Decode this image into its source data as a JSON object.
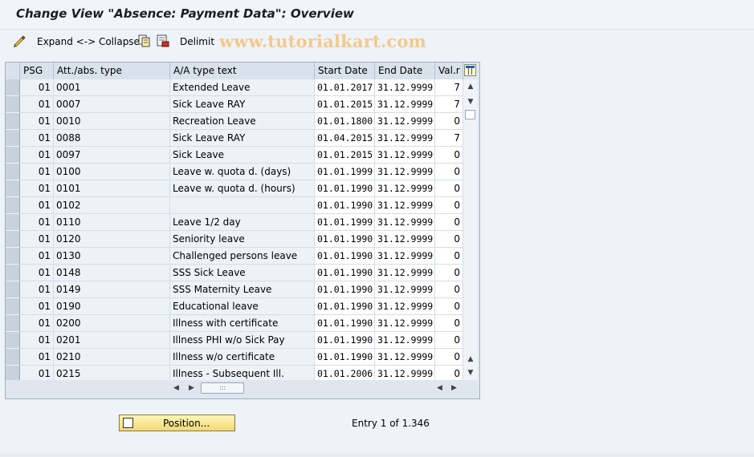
{
  "window": {
    "title": "Change View \"Absence: Payment Data\": Overview"
  },
  "toolbar": {
    "expand_collapse_label": "Expand <-> Collapse",
    "delimit_label": "Delimit"
  },
  "watermark": "www.tutorialkart.com",
  "table": {
    "headers": {
      "psg": "PSG",
      "type": "Att./abs. type",
      "text": "A/A type text",
      "start": "Start Date",
      "end": "End Date",
      "val": "Val.r"
    },
    "rows": [
      {
        "psg": "01",
        "type": "0001",
        "text": "Extended Leave",
        "start": "01.01.2017",
        "end": "31.12.9999",
        "val": "7"
      },
      {
        "psg": "01",
        "type": "0007",
        "text": "Sick Leave RAY",
        "start": "01.01.2015",
        "end": "31.12.9999",
        "val": "7"
      },
      {
        "psg": "01",
        "type": "0010",
        "text": "Recreation Leave",
        "start": "01.01.1800",
        "end": "31.12.9999",
        "val": "0"
      },
      {
        "psg": "01",
        "type": "0088",
        "text": "Sick Leave RAY",
        "start": "01.04.2015",
        "end": "31.12.9999",
        "val": "7"
      },
      {
        "psg": "01",
        "type": "0097",
        "text": "Sick Leave",
        "start": "01.01.2015",
        "end": "31.12.9999",
        "val": "0"
      },
      {
        "psg": "01",
        "type": "0100",
        "text": "Leave w. quota d. (days)",
        "start": "01.01.1999",
        "end": "31.12.9999",
        "val": "0"
      },
      {
        "psg": "01",
        "type": "0101",
        "text": "Leave w. quota d. (hours)",
        "start": "01.01.1990",
        "end": "31.12.9999",
        "val": "0"
      },
      {
        "psg": "01",
        "type": "0102",
        "text": "",
        "start": "01.01.1990",
        "end": "31.12.9999",
        "val": "0"
      },
      {
        "psg": "01",
        "type": "0110",
        "text": "Leave 1/2 day",
        "start": "01.01.1999",
        "end": "31.12.9999",
        "val": "0"
      },
      {
        "psg": "01",
        "type": "0120",
        "text": "Seniority leave",
        "start": "01.01.1990",
        "end": "31.12.9999",
        "val": "0"
      },
      {
        "psg": "01",
        "type": "0130",
        "text": "Challenged persons leave",
        "start": "01.01.1990",
        "end": "31.12.9999",
        "val": "0"
      },
      {
        "psg": "01",
        "type": "0148",
        "text": "SSS Sick Leave",
        "start": "01.01.1990",
        "end": "31.12.9999",
        "val": "0"
      },
      {
        "psg": "01",
        "type": "0149",
        "text": "SSS Maternity Leave",
        "start": "01.01.1990",
        "end": "31.12.9999",
        "val": "0"
      },
      {
        "psg": "01",
        "type": "0190",
        "text": "Educational leave",
        "start": "01.01.1990",
        "end": "31.12.9999",
        "val": "0"
      },
      {
        "psg": "01",
        "type": "0200",
        "text": "Illness with certificate",
        "start": "01.01.1990",
        "end": "31.12.9999",
        "val": "0"
      },
      {
        "psg": "01",
        "type": "0201",
        "text": "Illness PHI w/o Sick Pay",
        "start": "01.01.1990",
        "end": "31.12.9999",
        "val": "0"
      },
      {
        "psg": "01",
        "type": "0210",
        "text": "Illness w/o certificate",
        "start": "01.01.1990",
        "end": "31.12.9999",
        "val": "0"
      },
      {
        "psg": "01",
        "type": "0215",
        "text": "Illness - Subsequent Ill.",
        "start": "01.01.2006",
        "end": "31.12.9999",
        "val": "0"
      }
    ]
  },
  "footer": {
    "position_button": "Position...",
    "entry_text": "Entry 1 of 1.346"
  }
}
